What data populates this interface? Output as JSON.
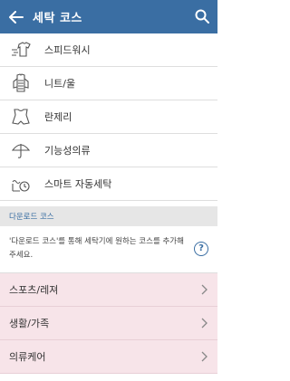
{
  "header": {
    "title": "세탁 코스"
  },
  "courses": [
    {
      "label": "스피드워시",
      "icon": "speed-wash-icon"
    },
    {
      "label": "니트/울",
      "icon": "knit-wool-icon"
    },
    {
      "label": "란제리",
      "icon": "lingerie-icon"
    },
    {
      "label": "기능성의류",
      "icon": "umbrella-icon"
    },
    {
      "label": "스마트 자동세탁",
      "icon": "smart-wash-icon"
    }
  ],
  "download": {
    "section_title": "다운로드 코스",
    "info_text": "'다운로드 코스'를 통해 세탁기에 원하는 코스를 추가해주세요.",
    "help_label": "?"
  },
  "categories": [
    {
      "label": "스포츠/레져"
    },
    {
      "label": "생활/가족"
    },
    {
      "label": "의류케어"
    }
  ],
  "colors": {
    "header": "#3a6ea3",
    "category_bg": "#f7e4e9",
    "section_bg": "#e6e6e6"
  }
}
